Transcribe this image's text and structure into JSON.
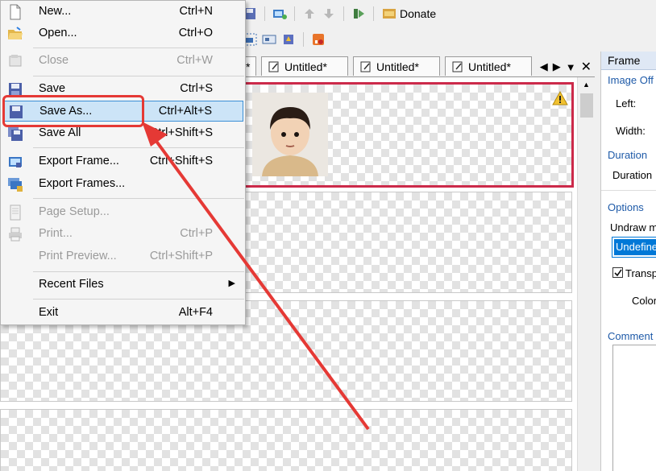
{
  "toolbar": {
    "donate_label": "Donate"
  },
  "tabs": [
    {
      "label": "Untitled*"
    },
    {
      "label": "Untitled*"
    },
    {
      "label": "Untitled*"
    }
  ],
  "tab_partial": "*",
  "menu": {
    "items": [
      {
        "label": "New...",
        "shortcut": "Ctrl+N"
      },
      {
        "label": "Open...",
        "shortcut": "Ctrl+O"
      },
      {
        "label": "Close",
        "shortcut": "Ctrl+W"
      },
      {
        "label": "Save",
        "shortcut": "Ctrl+S"
      },
      {
        "label": "Save As...",
        "shortcut": "Ctrl+Alt+S"
      },
      {
        "label": "Save All",
        "shortcut": "Ctrl+Shift+S"
      },
      {
        "label": "Export Frame...",
        "shortcut": "Ctrl+Shift+S"
      },
      {
        "label": "Export Frames...",
        "shortcut": ""
      },
      {
        "label": "Page Setup...",
        "shortcut": ""
      },
      {
        "label": "Print...",
        "shortcut": "Ctrl+P"
      },
      {
        "label": "Print Preview...",
        "shortcut": "Ctrl+Shift+P"
      },
      {
        "label": "Recent Files",
        "shortcut": ""
      },
      {
        "label": "Exit",
        "shortcut": "Alt+F4"
      }
    ]
  },
  "panel": {
    "title": "Frame",
    "image_offset": "Image Off",
    "left_label": "Left:",
    "width_label": "Width:",
    "duration_section": "Duration",
    "duration_label": "Duration",
    "options_section": "Options",
    "undraw_label": "Undraw m",
    "undraw_value": "Undefine",
    "transparent_label": "Transp",
    "color_label": "Color",
    "comment_section": "Comment"
  },
  "colors": {
    "menu_highlight": "#cce4f7",
    "selection_border": "#cc2a4a",
    "annotation_red": "#e53935",
    "panel_accent": "#1e5aa8"
  }
}
